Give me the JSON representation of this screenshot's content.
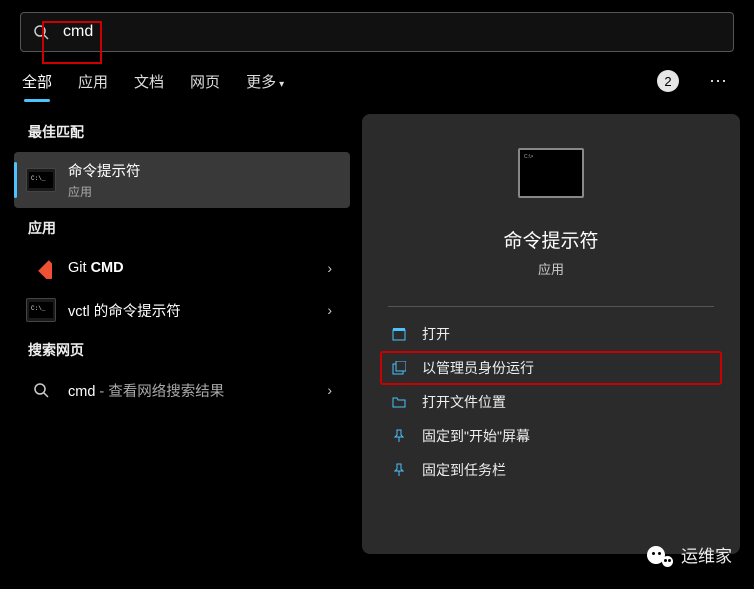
{
  "search": {
    "value": "cmd"
  },
  "tabs": {
    "items": [
      "全部",
      "应用",
      "文档",
      "网页",
      "更多"
    ],
    "activeIndex": 0,
    "count": "2"
  },
  "left": {
    "bestMatchHeader": "最佳匹配",
    "bestMatch": {
      "title": "命令提示符",
      "sub": "应用"
    },
    "appsHeader": "应用",
    "apps": [
      {
        "prefix": "Git ",
        "bold": "CMD"
      },
      {
        "title": "vctl 的命令提示符"
      }
    ],
    "webHeader": "搜索网页",
    "web": {
      "term": "cmd",
      "suffix": " - 查看网络搜索结果"
    }
  },
  "preview": {
    "title": "命令提示符",
    "sub": "应用",
    "actions": [
      "打开",
      "以管理员身份运行",
      "打开文件位置",
      "固定到\"开始\"屏幕",
      "固定到任务栏"
    ]
  },
  "watermark": "运维家"
}
